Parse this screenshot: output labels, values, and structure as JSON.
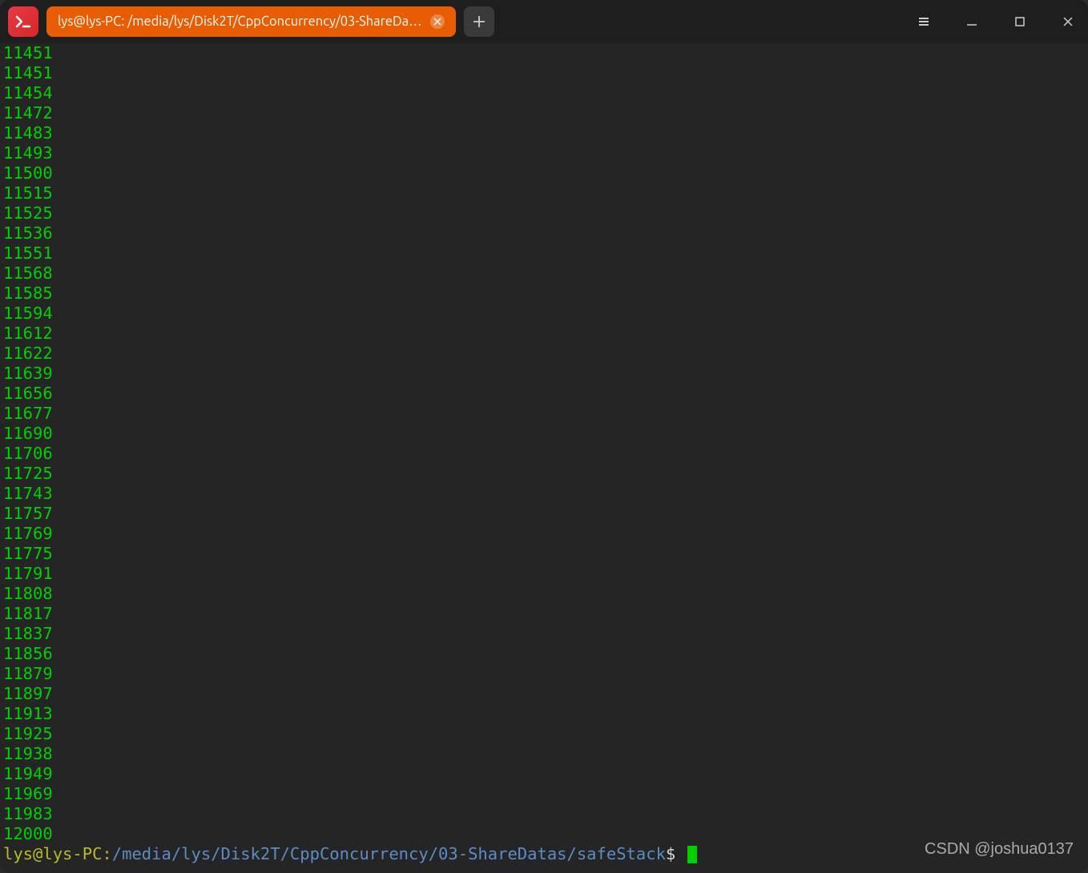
{
  "tab": {
    "title": "lys@lys-PC: /media/lys/Disk2T/CppConcurrency/03-ShareDa…"
  },
  "output": [
    "11451",
    "11451",
    "11454",
    "11472",
    "11483",
    "11493",
    "11500",
    "11515",
    "11525",
    "11536",
    "11551",
    "11568",
    "11585",
    "11594",
    "11612",
    "11622",
    "11639",
    "11656",
    "11677",
    "11690",
    "11706",
    "11725",
    "11743",
    "11757",
    "11769",
    "11775",
    "11791",
    "11808",
    "11817",
    "11837",
    "11856",
    "11879",
    "11897",
    "11913",
    "11925",
    "11938",
    "11949",
    "11969",
    "11983",
    "12000"
  ],
  "prompt": {
    "user_host": "lys@lys-PC",
    "colon": ":",
    "path": "/media/lys/Disk2T/CppConcurrency/03-ShareDatas/safeStack",
    "dollar": "$"
  },
  "watermark": "CSDN @joshua0137"
}
